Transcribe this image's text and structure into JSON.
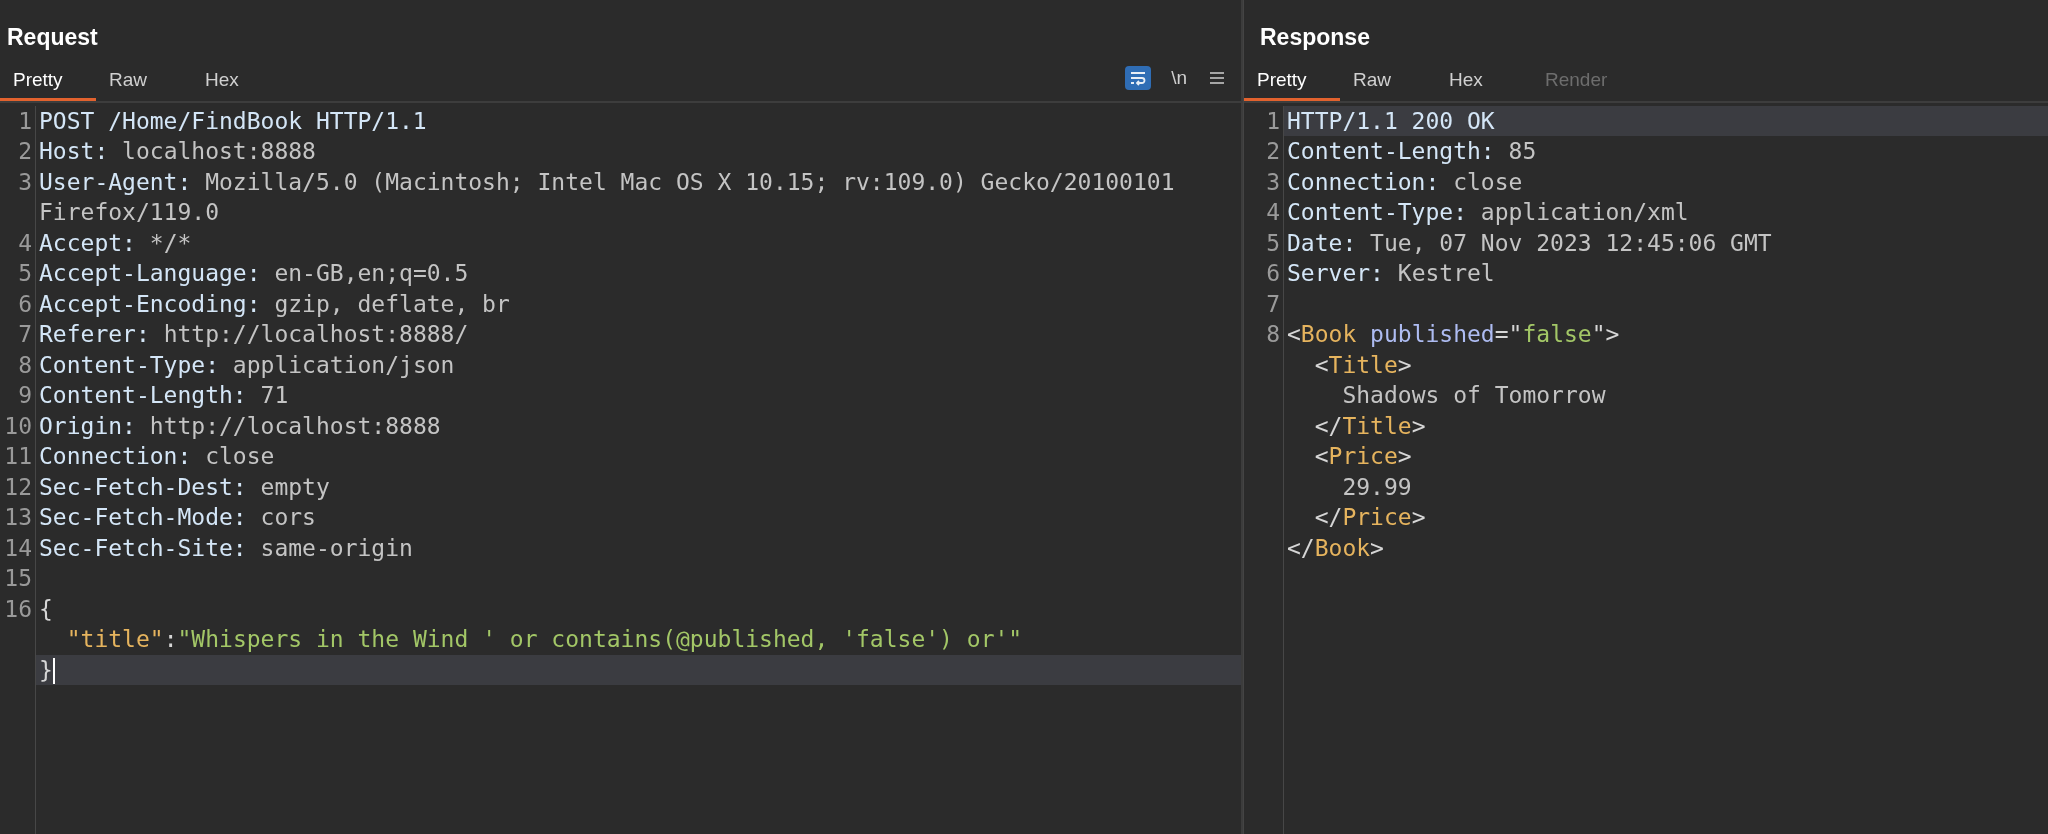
{
  "request": {
    "title": "Request",
    "tabs": [
      {
        "label": "Pretty",
        "selected": true,
        "disabled": false
      },
      {
        "label": "Raw",
        "selected": false,
        "disabled": false
      },
      {
        "label": "Hex",
        "selected": false,
        "disabled": false
      }
    ],
    "toolbar": {
      "wrap_toggle": {
        "on": true
      },
      "newline_toggle": {
        "label": "\\n",
        "on": false
      }
    },
    "lines": [
      {
        "number": "1",
        "current": false,
        "tokens": [
          {
            "kind": "name",
            "text": "POST /Home/FindBook HTTP/1.1"
          }
        ]
      },
      {
        "number": "2",
        "current": false,
        "tokens": [
          {
            "kind": "name",
            "text": "Host:"
          },
          {
            "kind": "value",
            "text": " localhost:8888"
          }
        ]
      },
      {
        "number": "3",
        "current": false,
        "tokens": [
          {
            "kind": "name",
            "text": "User-Agent:"
          },
          {
            "kind": "value",
            "text": " Mozilla/5.0 (Macintosh; Intel Mac OS X 10.15; rv:109.0) Gecko/20100101 Firefox/119.0"
          }
        ]
      },
      {
        "number": "4",
        "current": false,
        "tokens": [
          {
            "kind": "name",
            "text": "Accept:"
          },
          {
            "kind": "value",
            "text": " */*"
          }
        ]
      },
      {
        "number": "5",
        "current": false,
        "tokens": [
          {
            "kind": "name",
            "text": "Accept-Language:"
          },
          {
            "kind": "value",
            "text": " en-GB,en;q=0.5"
          }
        ]
      },
      {
        "number": "6",
        "current": false,
        "tokens": [
          {
            "kind": "name",
            "text": "Accept-Encoding:"
          },
          {
            "kind": "value",
            "text": " gzip, deflate, br"
          }
        ]
      },
      {
        "number": "7",
        "current": false,
        "tokens": [
          {
            "kind": "name",
            "text": "Referer:"
          },
          {
            "kind": "value",
            "text": " http://localhost:8888/"
          }
        ]
      },
      {
        "number": "8",
        "current": false,
        "tokens": [
          {
            "kind": "name",
            "text": "Content-Type:"
          },
          {
            "kind": "value",
            "text": " application/json"
          }
        ]
      },
      {
        "number": "9",
        "current": false,
        "tokens": [
          {
            "kind": "name",
            "text": "Content-Length:"
          },
          {
            "kind": "value",
            "text": " 71"
          }
        ]
      },
      {
        "number": "10",
        "current": false,
        "tokens": [
          {
            "kind": "name",
            "text": "Origin:"
          },
          {
            "kind": "value",
            "text": " http://localhost:8888"
          }
        ]
      },
      {
        "number": "11",
        "current": false,
        "tokens": [
          {
            "kind": "name",
            "text": "Connection:"
          },
          {
            "kind": "value",
            "text": " close"
          }
        ]
      },
      {
        "number": "12",
        "current": false,
        "tokens": [
          {
            "kind": "name",
            "text": "Sec-Fetch-Dest:"
          },
          {
            "kind": "value",
            "text": " empty"
          }
        ]
      },
      {
        "number": "13",
        "current": false,
        "tokens": [
          {
            "kind": "name",
            "text": "Sec-Fetch-Mode:"
          },
          {
            "kind": "value",
            "text": " cors"
          }
        ]
      },
      {
        "number": "14",
        "current": false,
        "tokens": [
          {
            "kind": "name",
            "text": "Sec-Fetch-Site:"
          },
          {
            "kind": "value",
            "text": " same-origin"
          }
        ]
      },
      {
        "number": "15",
        "current": false
      },
      {
        "number": "16",
        "current": false,
        "tokens": [
          {
            "kind": "punct",
            "text": "{"
          }
        ]
      },
      {
        "current": false,
        "tokens": [
          {
            "kind": "key",
            "text": "  \"title\""
          },
          {
            "kind": "punct",
            "text": ":"
          },
          {
            "kind": "string",
            "text": "\"Whispers in the Wind ' or contains(@published, 'false') or'\""
          }
        ]
      },
      {
        "current": true,
        "tokens": [
          {
            "kind": "punct",
            "text": "}"
          }
        ]
      }
    ]
  },
  "response": {
    "title": "Response",
    "tabs": [
      {
        "label": "Pretty",
        "selected": true,
        "disabled": false
      },
      {
        "label": "Raw",
        "selected": false,
        "disabled": false
      },
      {
        "label": "Hex",
        "selected": false,
        "disabled": false
      },
      {
        "label": "Render",
        "selected": false,
        "disabled": true
      }
    ],
    "lines": [
      {
        "number": "1",
        "current": true,
        "tokens": [
          {
            "kind": "name",
            "text": "HTTP/1.1 200 OK"
          }
        ]
      },
      {
        "number": "2",
        "current": false,
        "tokens": [
          {
            "kind": "name",
            "text": "Content-Length:"
          },
          {
            "kind": "value",
            "text": " 85"
          }
        ]
      },
      {
        "number": "3",
        "current": false,
        "tokens": [
          {
            "kind": "name",
            "text": "Connection:"
          },
          {
            "kind": "value",
            "text": " close"
          }
        ]
      },
      {
        "number": "4",
        "current": false,
        "tokens": [
          {
            "kind": "name",
            "text": "Content-Type:"
          },
          {
            "kind": "value",
            "text": " application/xml"
          }
        ]
      },
      {
        "number": "5",
        "current": false,
        "tokens": [
          {
            "kind": "name",
            "text": "Date:"
          },
          {
            "kind": "value",
            "text": " Tue, 07 Nov 2023 12:45:06 GMT"
          }
        ]
      },
      {
        "number": "6",
        "current": false,
        "tokens": [
          {
            "kind": "name",
            "text": "Server:"
          },
          {
            "kind": "value",
            "text": " Kestrel"
          }
        ]
      },
      {
        "number": "7",
        "current": false
      },
      {
        "number": "8",
        "current": false,
        "tokens": [
          {
            "kind": "punct",
            "text": "<"
          },
          {
            "kind": "tag",
            "text": "Book"
          },
          {
            "kind": "attr",
            "text": " published"
          },
          {
            "kind": "punct",
            "text": "=\""
          },
          {
            "kind": "string",
            "text": "false"
          },
          {
            "kind": "punct",
            "text": "\">"
          }
        ]
      },
      {
        "current": false,
        "tokens": [
          {
            "kind": "punct",
            "text": "  <"
          },
          {
            "kind": "tag",
            "text": "Title"
          },
          {
            "kind": "punct",
            "text": ">"
          }
        ]
      },
      {
        "current": false,
        "tokens": [
          {
            "kind": "value",
            "text": "    Shadows of Tomorrow"
          }
        ]
      },
      {
        "current": false,
        "tokens": [
          {
            "kind": "punct",
            "text": "  </"
          },
          {
            "kind": "tag",
            "text": "Title"
          },
          {
            "kind": "punct",
            "text": ">"
          }
        ]
      },
      {
        "current": false,
        "tokens": [
          {
            "kind": "punct",
            "text": "  <"
          },
          {
            "kind": "tag",
            "text": "Price"
          },
          {
            "kind": "punct",
            "text": ">"
          }
        ]
      },
      {
        "current": false,
        "tokens": [
          {
            "kind": "value",
            "text": "    29.99"
          }
        ]
      },
      {
        "current": false,
        "tokens": [
          {
            "kind": "punct",
            "text": "  </"
          },
          {
            "kind": "tag",
            "text": "Price"
          },
          {
            "kind": "punct",
            "text": ">"
          }
        ]
      },
      {
        "current": false,
        "tokens": [
          {
            "kind": "punct",
            "text": "</"
          },
          {
            "kind": "tag",
            "text": "Book"
          },
          {
            "kind": "punct",
            "text": ">"
          }
        ]
      }
    ]
  }
}
